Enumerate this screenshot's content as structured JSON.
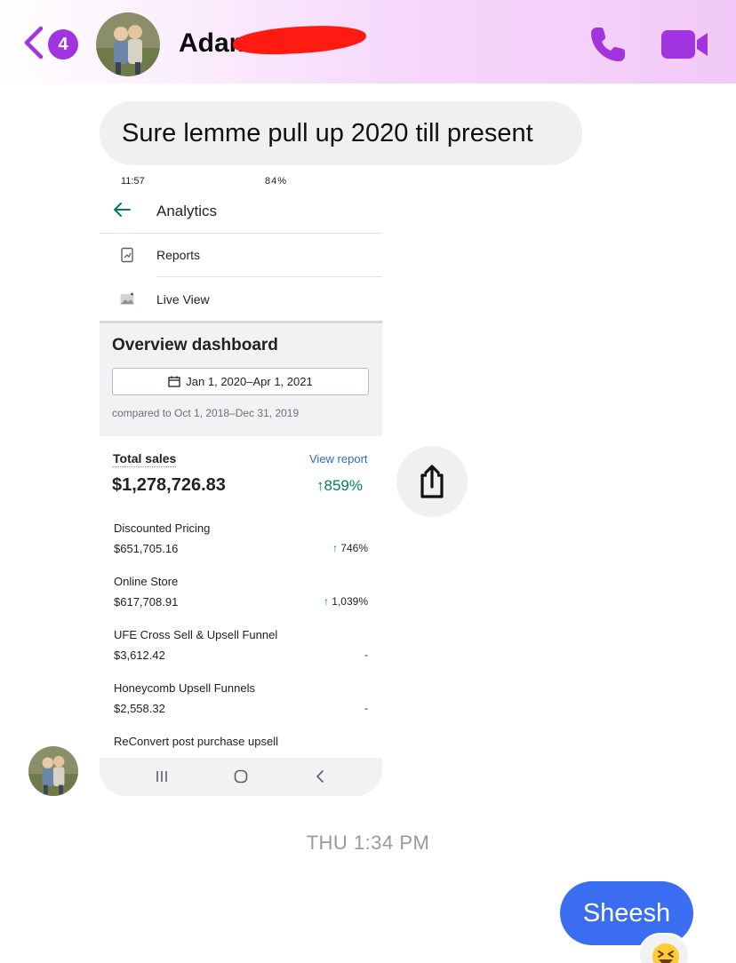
{
  "header": {
    "unread_count": "4",
    "contact_name": "Adam",
    "call_icon": "phone-icon",
    "video_icon": "video-camera-icon",
    "accent_color": "#a234e0"
  },
  "messages": {
    "incoming_text": "Sure lemme pull up 2020 till present",
    "timestamp": "THU 1:34 PM",
    "outgoing_text": "Sheesh",
    "outgoing_color": "#3b6df1",
    "reaction_icon": "grinning-squinting-face-icon"
  },
  "screenshot": {
    "status_time": "11:57",
    "status_right": "84%",
    "app_title": "Analytics",
    "menu": [
      {
        "label": "Reports",
        "icon": "reports-icon"
      },
      {
        "label": "Live View",
        "icon": "live-view-icon"
      }
    ],
    "overview_title": "Overview dashboard",
    "date_range": "Jan 1, 2020–Apr 1, 2021",
    "compared_to": "compared to Oct 1, 2018–Dec 31, 2019",
    "total_sales_label": "Total sales",
    "view_report": "View report",
    "total_sales_value": "$1,278,726.83",
    "total_sales_change": "859%",
    "items": [
      {
        "label": "Discounted Pricing",
        "value": "$651,705.16",
        "change": "746%",
        "arrow": "↑"
      },
      {
        "label": "Online Store",
        "value": "$617,708.91",
        "change": "1,039%",
        "arrow": "↑"
      },
      {
        "label": "UFE Cross Sell & Upsell Funnel",
        "value": "$3,612.42",
        "change": "-",
        "arrow": ""
      },
      {
        "label": "Honeycomb Upsell Funnels",
        "value": "$2,558.32",
        "change": "-",
        "arrow": ""
      },
      {
        "label": "ReConvert post purchase upsell",
        "value": "",
        "change": "",
        "arrow": ""
      }
    ],
    "positive_color": "#007f5f",
    "link_color": "#2c6ecb"
  }
}
